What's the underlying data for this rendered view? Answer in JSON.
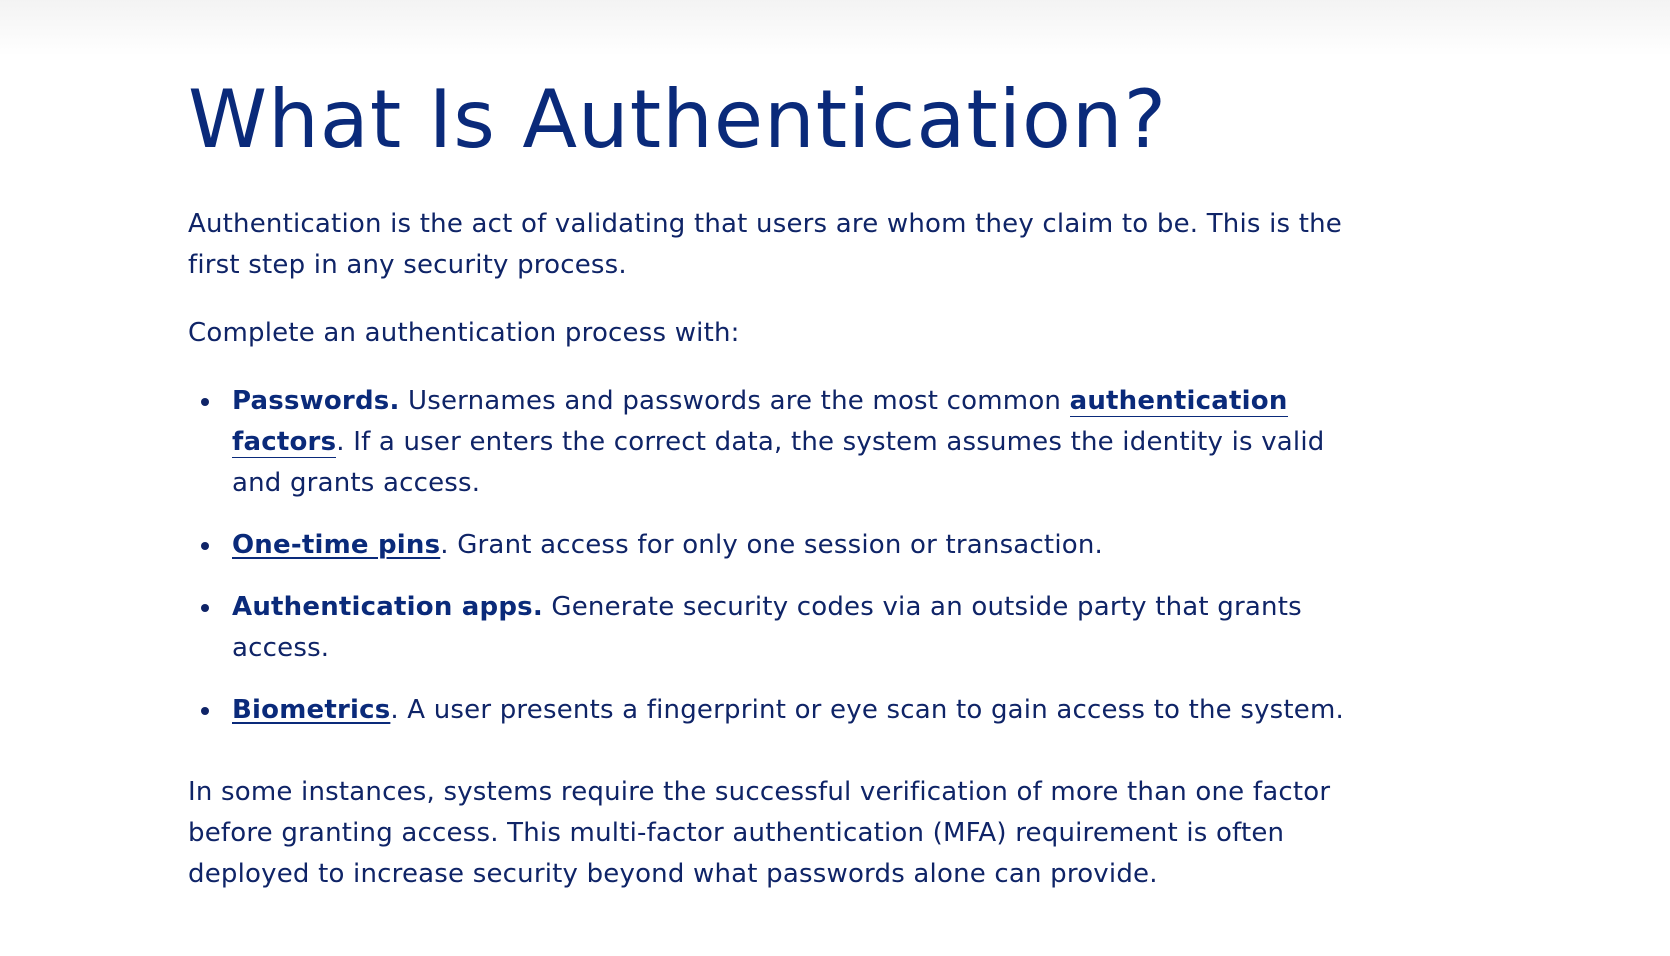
{
  "page": {
    "title": "What Is Authentication?",
    "intro": "Authentication is the act of validating that users are whom they claim to be. This is the first step in any security process.",
    "lead_in": "Complete an authentication process with:",
    "closing": "In some instances, systems require the successful verification of more than one factor before granting access. This multi-factor authentication (MFA) requirement is often deployed to increase security beyond what passwords alone can provide."
  },
  "methods": [
    {
      "term": "Passwords.",
      "text_before_link": " Usernames and passwords are the most common ",
      "link": "authentication factors",
      "text_after_link": ". If a user enters the correct data, the system assumes the identity is valid and grants access."
    },
    {
      "link": "One-time pins",
      "text_after_link": ". Grant access for only one session or transaction."
    },
    {
      "term": "Authentication apps.",
      "text": " Generate security codes via an outside party that grants access."
    },
    {
      "link": "Biometrics",
      "text_after_link": ". A user presents a fingerprint or eye scan to gain access to the system."
    }
  ]
}
